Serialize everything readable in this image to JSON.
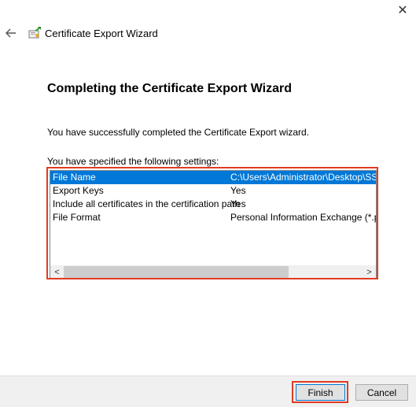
{
  "window": {
    "title": "Certificate Export Wizard",
    "close_glyph": "✕",
    "back_glyph": "←"
  },
  "page": {
    "heading": "Completing the Certificate Export Wizard",
    "success_text": "You have successfully completed the Certificate Export wizard.",
    "settings_label": "You have specified the following settings:"
  },
  "settings": [
    {
      "name": "File Name",
      "value": "C:\\Users\\Administrator\\Desktop\\SSL C",
      "selected": true
    },
    {
      "name": "Export Keys",
      "value": "Yes",
      "selected": false
    },
    {
      "name": "Include all certificates in the certification path",
      "value": "Yes",
      "selected": false
    },
    {
      "name": "File Format",
      "value": "Personal Information Exchange (*.pfx)",
      "selected": false
    }
  ],
  "scrollbar": {
    "left_glyph": "<",
    "right_glyph": ">"
  },
  "buttons": {
    "finish": "Finish",
    "cancel": "Cancel"
  },
  "colors": {
    "selection": "#0078d7",
    "highlight_outline": "#e03c24"
  }
}
